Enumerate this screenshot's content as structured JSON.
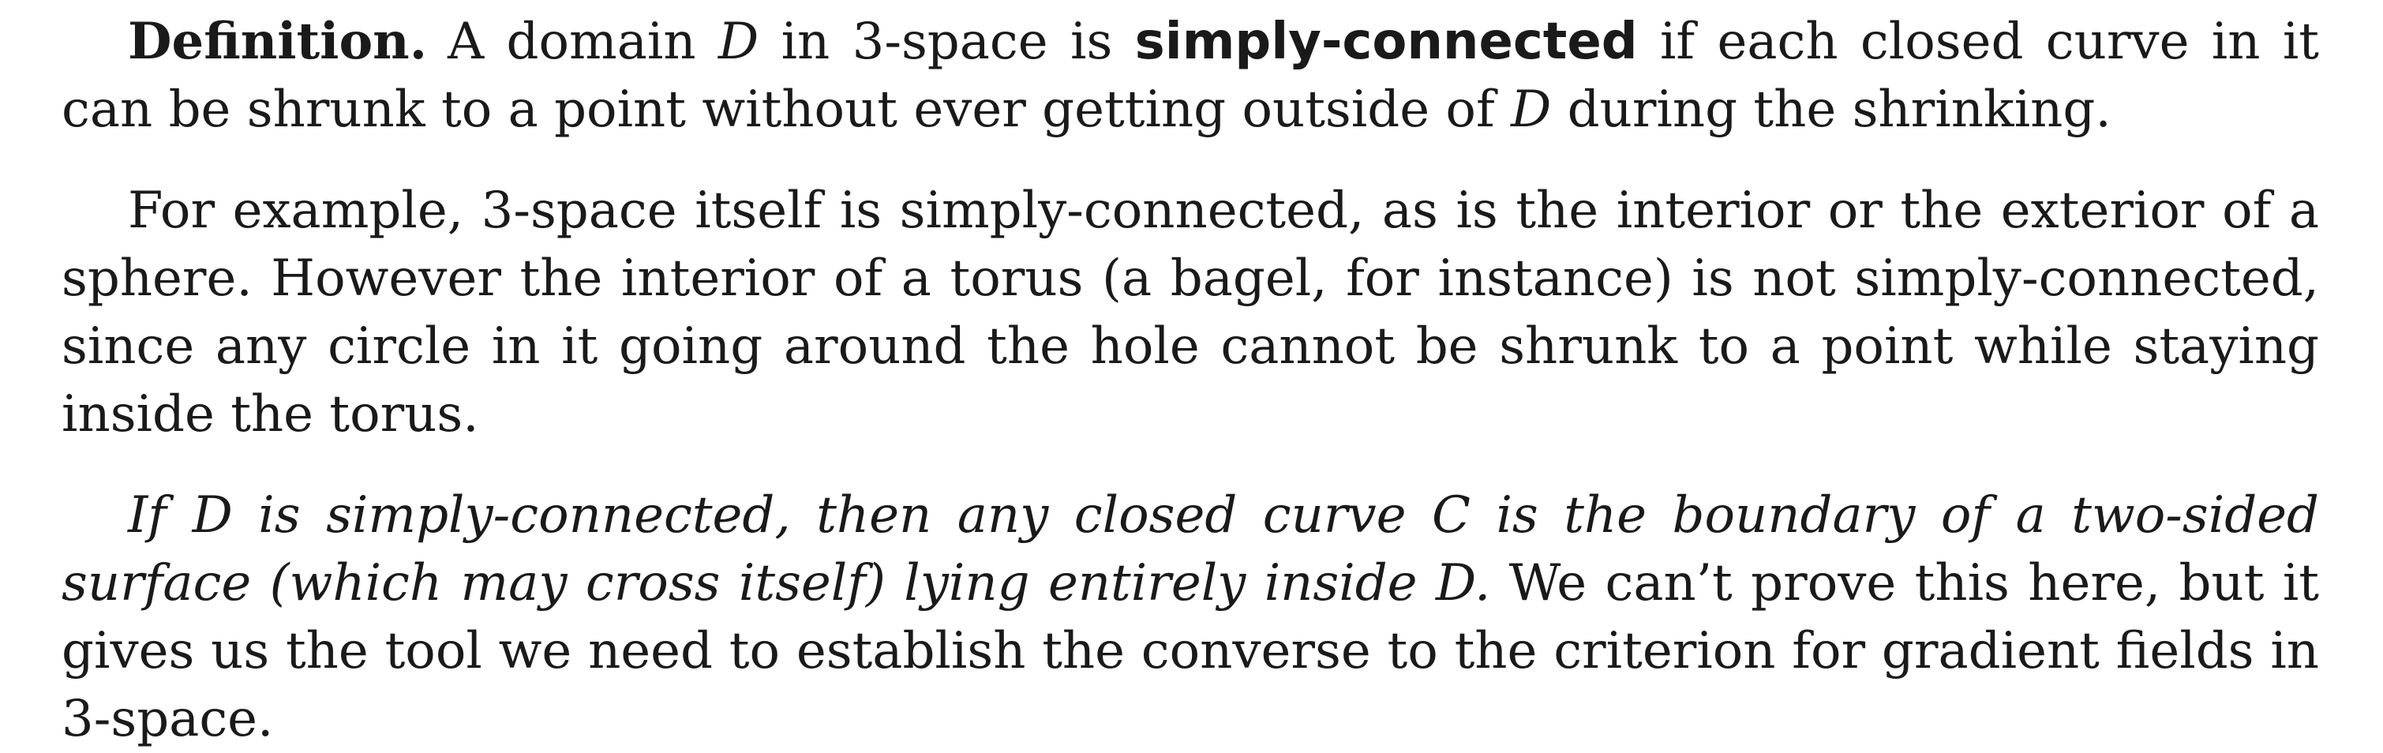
{
  "definition": {
    "label": "Definition.",
    "text_before": "A domain ",
    "var1": "D",
    "text_mid": " in 3-space is ",
    "term": "simply-connected",
    "text_after": " if each closed curve in it can be shrunk to a point without ever getting outside of ",
    "var2": "D",
    "text_end": " during the shrinking."
  },
  "example": {
    "text": "For example, 3-space itself is simply-connected, as is the interior or the exterior of a sphere. However the interior of a torus (a bagel, for instance) is not simply-connected, since any circle in it going around the hole cannot be shrunk to a point while staying inside the torus."
  },
  "theorem": {
    "italic_text": "If D is simply-connected, then any closed curve C is the boundary of a two-sided surface (which may cross itself) lying entirely inside D.",
    "normal_text": " We can’t prove this here, but it gives us the tool we need to establish the converse to the criterion for gradient fields in 3-space."
  }
}
